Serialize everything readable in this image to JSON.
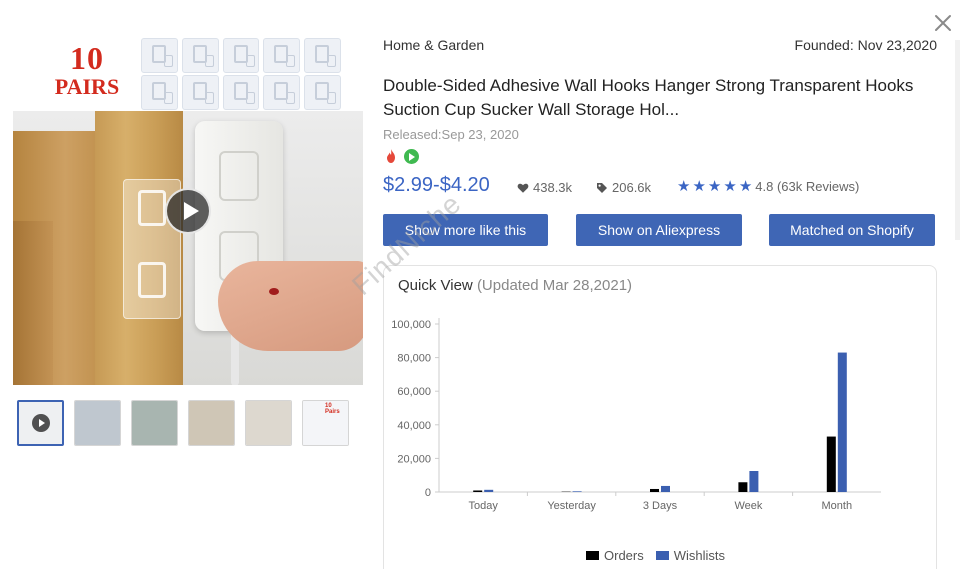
{
  "close_label": "✕",
  "banner": {
    "brand_line1": "10",
    "brand_line2": "PAIRS"
  },
  "thumbnails": [
    {
      "label": "",
      "bg": "#eef0f2",
      "video": true
    },
    {
      "label": "",
      "bg": "#bfc7cf",
      "video": false
    },
    {
      "label": "",
      "bg": "#a8b5b0",
      "video": false
    },
    {
      "label": "",
      "bg": "#cfc6b6",
      "video": false
    },
    {
      "label": "",
      "bg": "#ddd8cf",
      "video": false
    },
    {
      "label": "10 Pairs",
      "bg": "#f4f5f8",
      "video": false
    }
  ],
  "product": {
    "category": "Home & Garden",
    "founded": "Founded: Nov 23,2020",
    "title": "Double-Sided Adhesive Wall Hooks Hanger Strong Transparent Hooks Suction Cup Sucker Wall Storage Hol...",
    "released": "Released:Sep 23, 2020",
    "price": "$2.99-$4.20",
    "likes": "438.3k",
    "tags_count": "206.6k",
    "rating": 4.8,
    "rating_text": "4.8 (63k Reviews)"
  },
  "buttons": {
    "more_like": "Show more like this",
    "aliexpress": "Show on Aliexpress",
    "shopify": "Matched on Shopify"
  },
  "watermark": "FindNiche",
  "quick_view": {
    "title": "Quick View",
    "updated": "(Updated Mar 28,2021)"
  },
  "colors": {
    "accent": "#3f66b5",
    "orders": "#000000",
    "wishlists": "#3b5fb0"
  },
  "chart_data": {
    "type": "bar",
    "categories": [
      "Today",
      "Yesterday",
      "3 Days",
      "Week",
      "Month"
    ],
    "series": [
      {
        "name": "Orders",
        "values": [
          900,
          200,
          1800,
          5800,
          33000
        ]
      },
      {
        "name": "Wishlists",
        "values": [
          1300,
          400,
          3600,
          12500,
          83000
        ]
      }
    ],
    "yticks": [
      "0",
      "20,000",
      "40,000",
      "60,000",
      "80,000",
      "100,000"
    ],
    "ylim": [
      0,
      100000
    ],
    "legend_position": "bottom",
    "grid": false
  }
}
